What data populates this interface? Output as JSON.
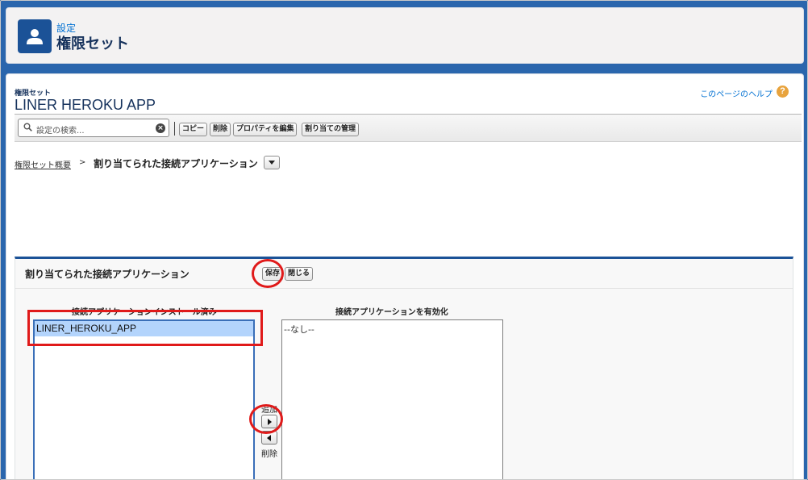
{
  "header": {
    "breadcrumb": "設定",
    "title": "権限セット"
  },
  "record": {
    "type_label": "権限セット",
    "name": "LINER HEROKU APP",
    "help_link": "このページのヘルプ",
    "help_icon": "?"
  },
  "toolbar": {
    "search_placeholder": "設定の検索...",
    "buttons": {
      "copy": "コピー",
      "delete": "削除",
      "edit_properties": "プロパティを編集",
      "manage_assignments": "割り当ての管理"
    }
  },
  "breadcrumb": {
    "parent": "権限セット概要",
    "separator": ">",
    "current": "割り当てられた接続アプリケーション"
  },
  "section": {
    "title": "割り当てられた接続アプリケーション",
    "save_label": "保存",
    "close_label": "閉じる",
    "installed": {
      "label": "接続アプリケーションインストール済み",
      "items": [
        "LINER_HEROKU_APP"
      ]
    },
    "enabled": {
      "label": "接続アプリケーションを有効化",
      "empty": "--なし--"
    },
    "add_label": "追加",
    "remove_label": "削除"
  },
  "colors": {
    "accent": "#1b5297",
    "link": "#0070d2",
    "annotation": "#e01a1a",
    "selection": "#b3d4fc"
  },
  "icons": {
    "header": "user-icon",
    "search": "search-icon",
    "clear": "clear-icon",
    "help": "help-icon"
  }
}
